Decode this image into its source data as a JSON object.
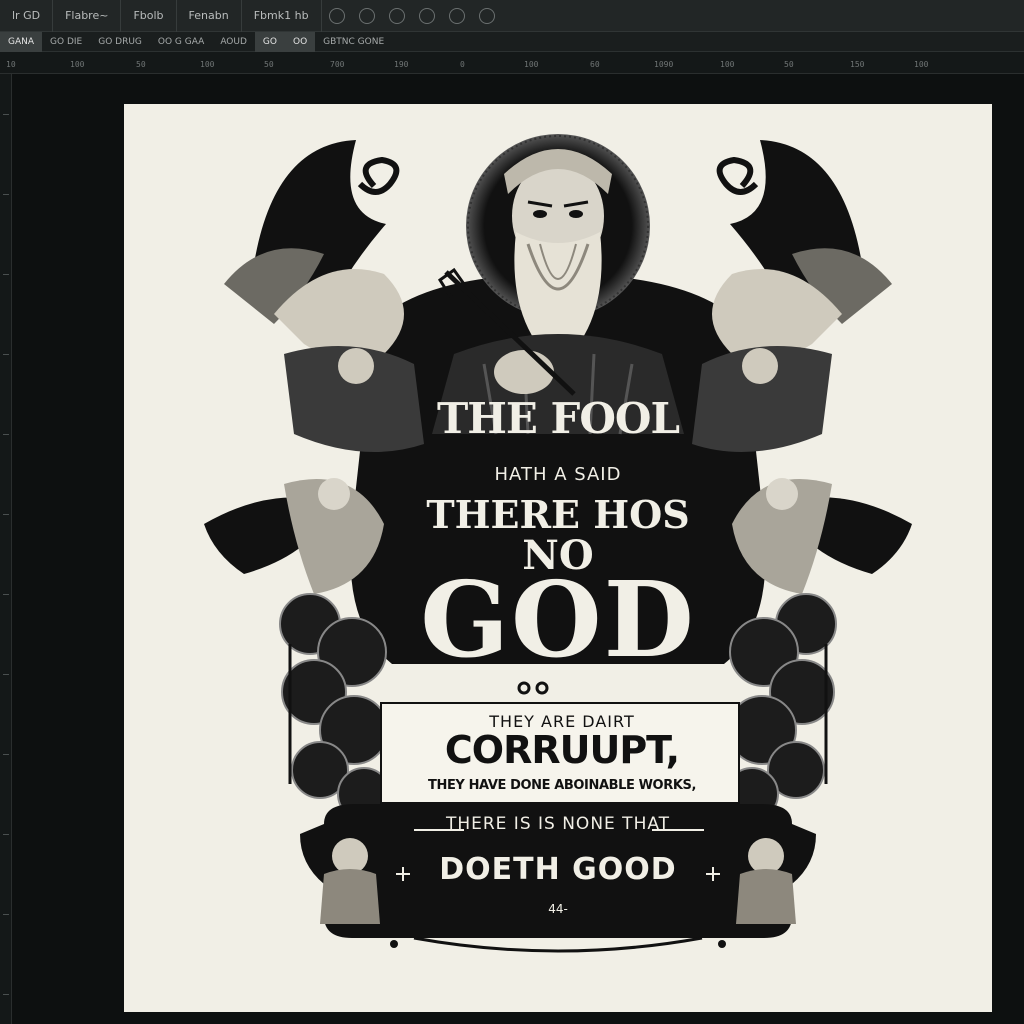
{
  "menubar": {
    "items": [
      "lr GD",
      "Flabre~",
      "Fbolb",
      "Fenabn",
      "Fbmk1 hb"
    ]
  },
  "options_bar": {
    "chips": [
      "GANA",
      "GO DIE",
      "GO DRUG",
      "OO G GAA",
      "AOUD",
      "GO",
      "OO",
      "GBTNC GONE"
    ]
  },
  "ruler": {
    "ticks": [
      "10",
      "100",
      "50",
      "100",
      "50",
      "700",
      "190",
      "0",
      "100",
      "60",
      "1090",
      "100",
      "50",
      "150",
      "100"
    ]
  },
  "artwork": {
    "title_line1": "THE FOOL",
    "line_hath_said": "HATH A SAID",
    "line_there": "THERE HOS",
    "line_no": "NO",
    "line_god": "GOD",
    "panel_small": "THEY ARE DAIRT",
    "panel_big": "CORRUUPT,",
    "panel_works": "THEY HAVE DONE ABOINABLE WORKS,",
    "line_none_that": "THERE IS IS NONE  THAT",
    "line_doeth_good": "DOETH GOOD",
    "page_number": "44-"
  },
  "colors": {
    "paper": "#f1efe6",
    "ink": "#111111",
    "chrome": "#222626"
  }
}
